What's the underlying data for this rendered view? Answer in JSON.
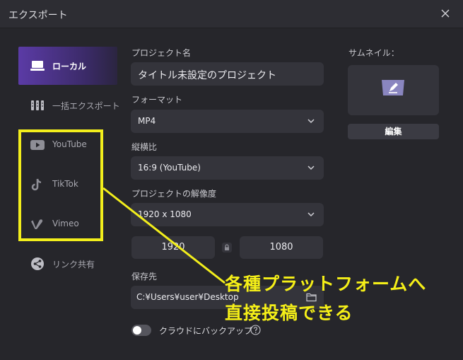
{
  "window": {
    "title": "エクスポート",
    "close_icon": "close-icon"
  },
  "sidebar": {
    "items": [
      {
        "label": "ローカル",
        "icon": "laptop-icon",
        "active": true
      },
      {
        "label": "一括エクスポート",
        "icon": "batch-icon",
        "active": false
      },
      {
        "label": "YouTube",
        "icon": "youtube-icon",
        "active": false
      },
      {
        "label": "TikTok",
        "icon": "tiktok-icon",
        "active": false
      },
      {
        "label": "Vimeo",
        "icon": "vimeo-icon",
        "active": false
      },
      {
        "label": "リンク共有",
        "icon": "share-icon",
        "active": false
      }
    ]
  },
  "form": {
    "project_name": {
      "label": "プロジェクト名",
      "value": "タイトル未設定のプロジェクト"
    },
    "format": {
      "label": "フォーマット",
      "value": "MP4"
    },
    "aspect": {
      "label": "縦横比",
      "value": "16:9 (YouTube)"
    },
    "resolution": {
      "label": "プロジェクトの解像度",
      "value": "1920 x 1080",
      "width": "1920",
      "height": "1080"
    },
    "save_to": {
      "label": "保存先",
      "value": "C:¥Users¥user¥Desktop"
    },
    "cloud_backup": {
      "label": "クラウドにバックアップ",
      "enabled": false
    }
  },
  "thumbnail": {
    "label": "サムネイル：",
    "edit_label": "編集"
  },
  "annotation": {
    "line1": "各種プラットフォームへ",
    "line2": "直接投稿できる",
    "color": "#f2ee1c"
  },
  "colors": {
    "accent": "#5b3ba6",
    "background": "#26262b",
    "field": "#34343b"
  }
}
